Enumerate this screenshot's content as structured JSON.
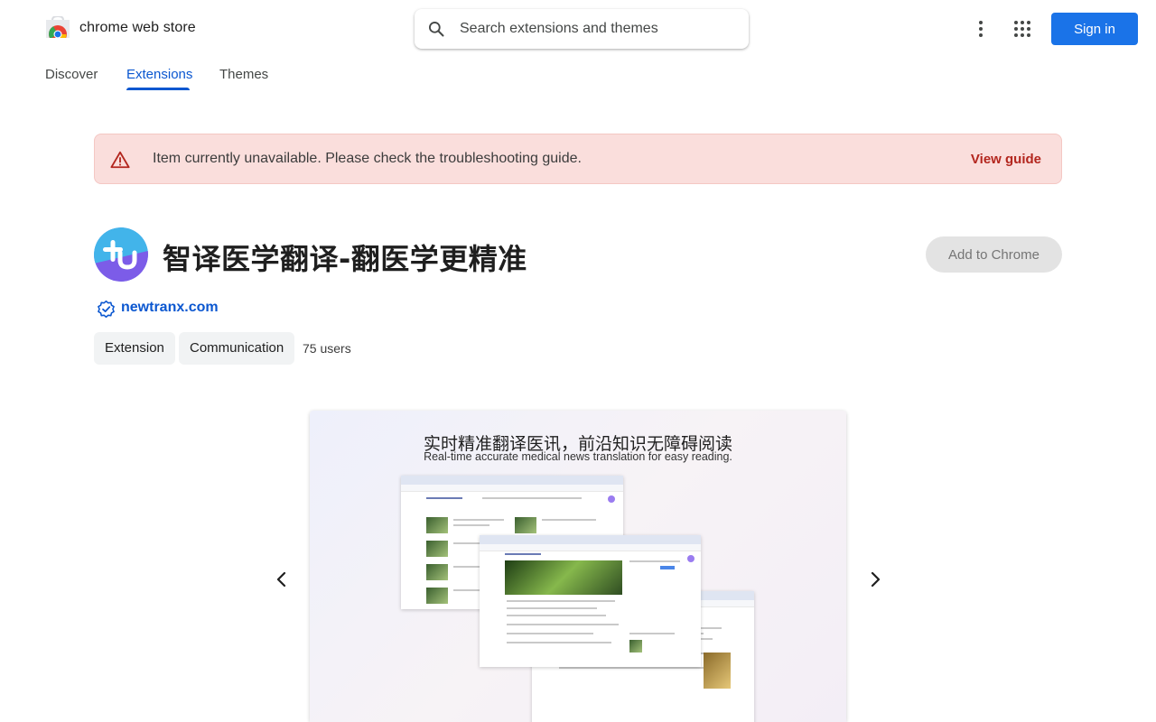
{
  "header": {
    "brand": "chrome web store",
    "search_placeholder": "Search extensions and themes",
    "signin_label": "Sign in"
  },
  "tabs": [
    {
      "label": "Discover"
    },
    {
      "label": "Extensions",
      "active": true
    },
    {
      "label": "Themes"
    }
  ],
  "alert": {
    "message": "Item currently unavailable. Please check the troubleshooting guide.",
    "link_label": "View guide"
  },
  "item": {
    "title": "智译医学翻译-翻医学更精准",
    "publisher": "newtranx.com",
    "add_label": "Add to Chrome",
    "chips": [
      "Extension",
      "Communication"
    ],
    "users": "75 users"
  },
  "screenshot": {
    "title": "实时精准翻译医讯，前沿知识无障碍阅读",
    "subtitle": "Real-time accurate medical news translation for easy reading."
  },
  "colors": {
    "accent": "#0b57d0",
    "signin_bg": "#1a73e8",
    "alert_bg": "#fadedc",
    "alert_link": "#b3261e"
  },
  "icons": {
    "logo": "chrome-web-store-logo",
    "search": "search-icon",
    "more": "more-vert-icon",
    "apps": "apps-grid-icon",
    "alert": "warning-icon",
    "verified": "verified-badge-icon",
    "prev": "chevron-left-icon",
    "next": "chevron-right-icon"
  }
}
